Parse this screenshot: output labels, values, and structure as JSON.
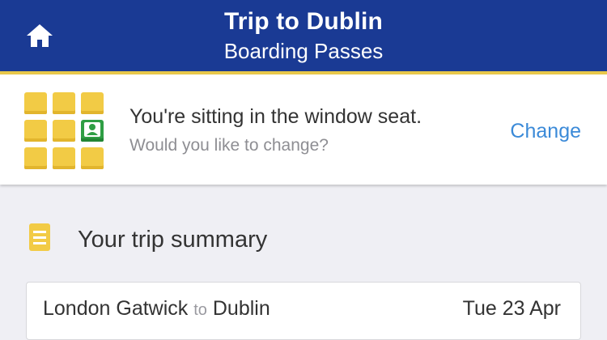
{
  "header": {
    "title": "Trip to Dublin",
    "subtitle": "Boarding Passes",
    "home_icon": "home-icon",
    "background_color": "#1a3a94",
    "accent_color": "#e8c84a"
  },
  "seat_banner": {
    "message": "You're sitting in the window seat.",
    "prompt": "Would you like to change?",
    "change_label": "Change",
    "seat_icon": "seat-map-icon",
    "selected_seat_icon": "person-icon",
    "seat_color": "#f2cb45",
    "selected_seat_color": "#2f9e44",
    "link_color": "#3b8ad8"
  },
  "summary": {
    "title": "Your trip summary",
    "icon": "document-icon"
  },
  "trip": {
    "origin": "London Gatwick",
    "connector": "to",
    "destination": "Dublin",
    "date": "Tue 23 Apr"
  }
}
